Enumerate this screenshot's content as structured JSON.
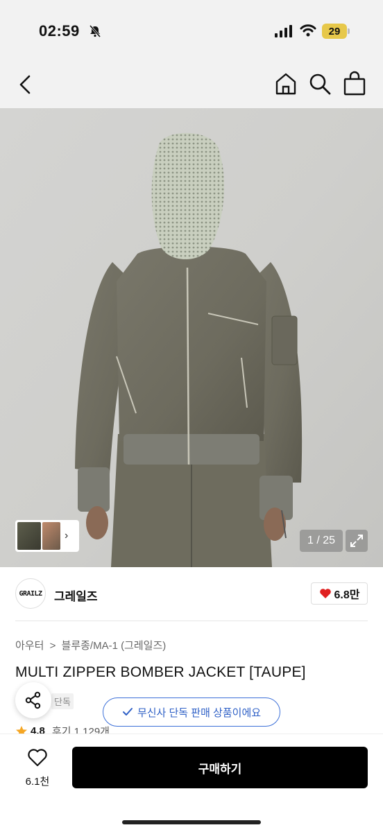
{
  "status": {
    "time": "02:59",
    "battery": "29"
  },
  "hero": {
    "counter": "1 / 25"
  },
  "brand": {
    "logo_text": "GRAILZ",
    "name": "그레일즈",
    "likes": "6.8만"
  },
  "breadcrumb": [
    "아우터",
    ">",
    "블루종/MA-1 (그레일즈)"
  ],
  "product": {
    "title": "MULTI ZIPPER BOMBER JACKET [TAUPE]",
    "tag": "단독",
    "exclusive_text": "무신사 단독 판매 상품이에요",
    "rating": "4.8",
    "reviews": "후기 1,129개"
  },
  "bottom": {
    "wish_count": "6.1천",
    "buy_label": "구매하기"
  },
  "colors": {
    "accent_blue": "#3b6fd8",
    "heart_red": "#e02020",
    "star": "#f5a623"
  },
  "icons": [
    "back-icon",
    "home-icon",
    "search-icon",
    "bag-icon",
    "share-icon",
    "heart-icon",
    "expand-icon",
    "check-icon",
    "star-icon"
  ]
}
